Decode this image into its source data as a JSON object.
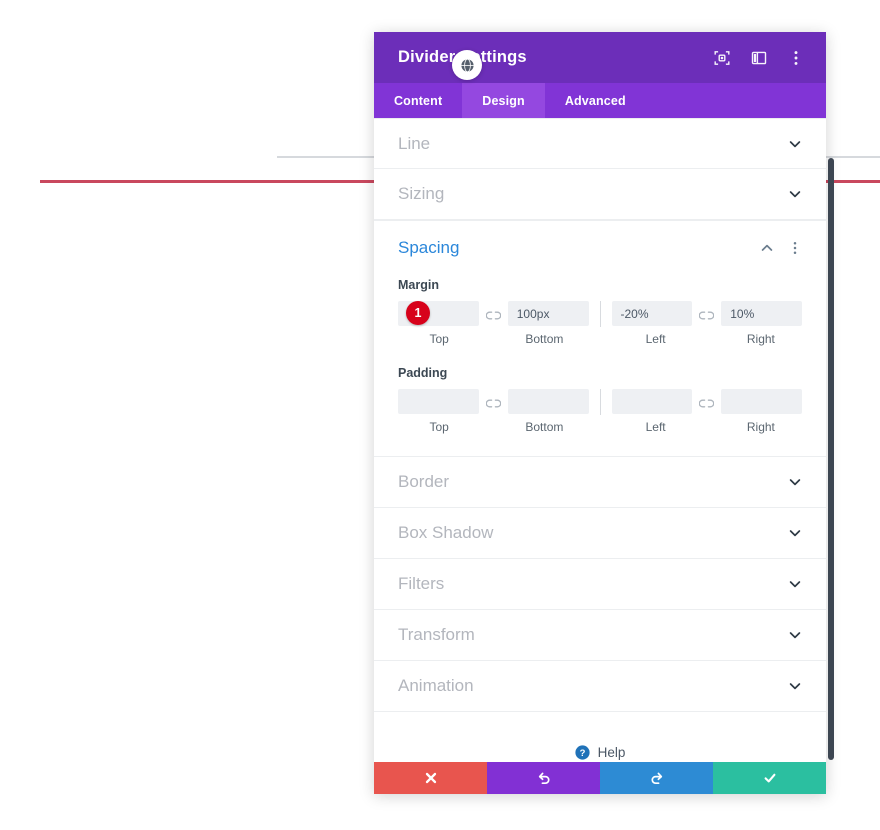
{
  "background": {
    "gray_divider": "divider-preview-line-gray",
    "red_divider": "divider-preview-line-red"
  },
  "panel": {
    "title": "Divider Settings",
    "header_icons": [
      {
        "name": "focus-target-icon",
        "label": "Focus"
      },
      {
        "name": "layout-panel-icon",
        "label": "Change Layout"
      },
      {
        "name": "more-vertical-icon",
        "label": "More Options"
      }
    ],
    "round_button": {
      "name": "disabled-globe-icon",
      "label": "Disabled"
    },
    "tabs": [
      {
        "label": "Content",
        "active": false
      },
      {
        "label": "Design",
        "active": true
      },
      {
        "label": "Advanced",
        "active": false
      }
    ],
    "sections": [
      {
        "label": "Line",
        "open": false
      },
      {
        "label": "Sizing",
        "open": false
      }
    ],
    "spacing_section": {
      "label": "Spacing",
      "open": true,
      "margin": {
        "label": "Margin",
        "badge": "1",
        "fields": [
          {
            "label": "Top",
            "value": "",
            "placeholder": ""
          },
          {
            "label": "Bottom",
            "value": "100px",
            "placeholder": ""
          },
          {
            "label": "Left",
            "value": "-20%",
            "placeholder": ""
          },
          {
            "label": "Right",
            "value": "10%",
            "placeholder": ""
          }
        ]
      },
      "padding": {
        "label": "Padding",
        "fields": [
          {
            "label": "Top",
            "value": "",
            "placeholder": ""
          },
          {
            "label": "Bottom",
            "value": "",
            "placeholder": ""
          },
          {
            "label": "Left",
            "value": "",
            "placeholder": ""
          },
          {
            "label": "Right",
            "value": "",
            "placeholder": ""
          }
        ]
      }
    },
    "sections_after": [
      {
        "label": "Border",
        "open": false
      },
      {
        "label": "Box Shadow",
        "open": false
      },
      {
        "label": "Filters",
        "open": false
      },
      {
        "label": "Transform",
        "open": false
      },
      {
        "label": "Animation",
        "open": false
      }
    ],
    "help": {
      "label": "Help",
      "icon": "question-circle-icon"
    },
    "footer_buttons": [
      {
        "name": "cancel-button",
        "icon": "close-icon",
        "color": "#e8554e"
      },
      {
        "name": "undo-button",
        "icon": "undo-icon",
        "color": "#8230d4"
      },
      {
        "name": "redo-button",
        "icon": "redo-icon",
        "color": "#2d8bd4"
      },
      {
        "name": "save-button",
        "icon": "check-icon",
        "color": "#2bbfa0"
      }
    ]
  },
  "colors": {
    "header_purple": "#6c2eb9",
    "tabbar_purple": "#8134d6",
    "tab_active_purple": "#9448e0",
    "accent_blue": "#2b87da",
    "badge_red": "#d7021b",
    "divider_red": "#c9485e",
    "scrollbar": "#3d4652"
  }
}
